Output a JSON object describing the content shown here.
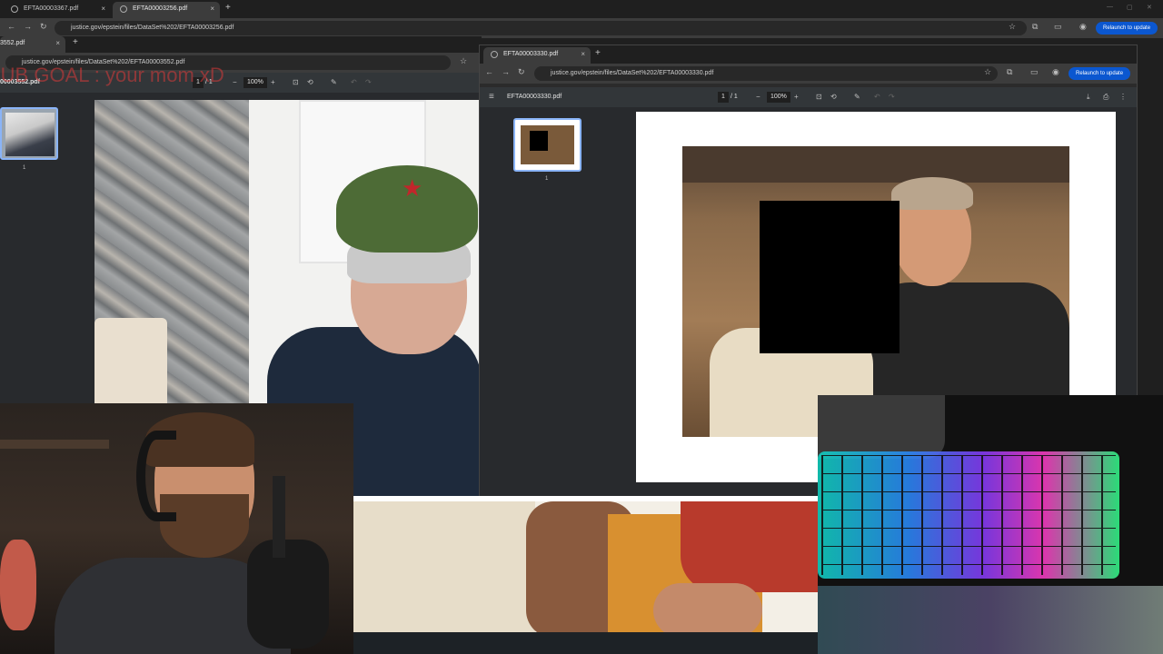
{
  "top_window": {
    "tabs": [
      {
        "label": "EFTA00003367.pdf",
        "close": "×"
      },
      {
        "label": "EFTA00003256.pdf",
        "close": "×"
      }
    ],
    "new_tab": "+",
    "url": "justice.gov/epstein/files/DataSet%202/EFTA00003256.pdf",
    "relaunch": "Relaunch to update",
    "window_controls": [
      "—",
      "▢",
      "✕"
    ]
  },
  "left_window": {
    "tab_label": "3552.pdf",
    "tab_close": "×",
    "new_tab": "+",
    "url": "justice.gov/epstein/files/DataSet%202/EFTA00003552.pdf",
    "pdf_title": "00003552.pdf",
    "page_current": "1",
    "page_total": "/ 1",
    "zoom": "100%",
    "thumb_label": "1",
    "overlay_text": "SUB GOAL : your mom xD"
  },
  "right_window": {
    "tab_label": "EFTA00003330.pdf",
    "tab_close": "×",
    "new_tab": "+",
    "url": "justice.gov/epstein/files/DataSet%202/EFTA00003330.pdf",
    "relaunch": "Relaunch to update",
    "pdf_title": "EFTA00003330.pdf",
    "page_current": "1",
    "page_total": "/ 1",
    "zoom": "100%",
    "thumb_label": "1"
  },
  "icons": {
    "back": "←",
    "forward": "→",
    "reload": "↻",
    "star": "☆",
    "menu": "≡",
    "minus": "−",
    "plus": "+",
    "download": "⤓",
    "print": "⎙",
    "more": "⋮",
    "undo": "↶",
    "redo": "↷",
    "fit": "⊡",
    "rotate": "⟲",
    "draw": "✎",
    "profile": "◉",
    "extensions": "⧉",
    "sidepanel": "▭"
  },
  "colors": {
    "chrome_dark": "#1f1f1f",
    "toolbar": "#3c3c3c",
    "pdf_toolbar": "#323639",
    "accent": "#0b57d0",
    "overlay_text": "#d93a3a"
  }
}
